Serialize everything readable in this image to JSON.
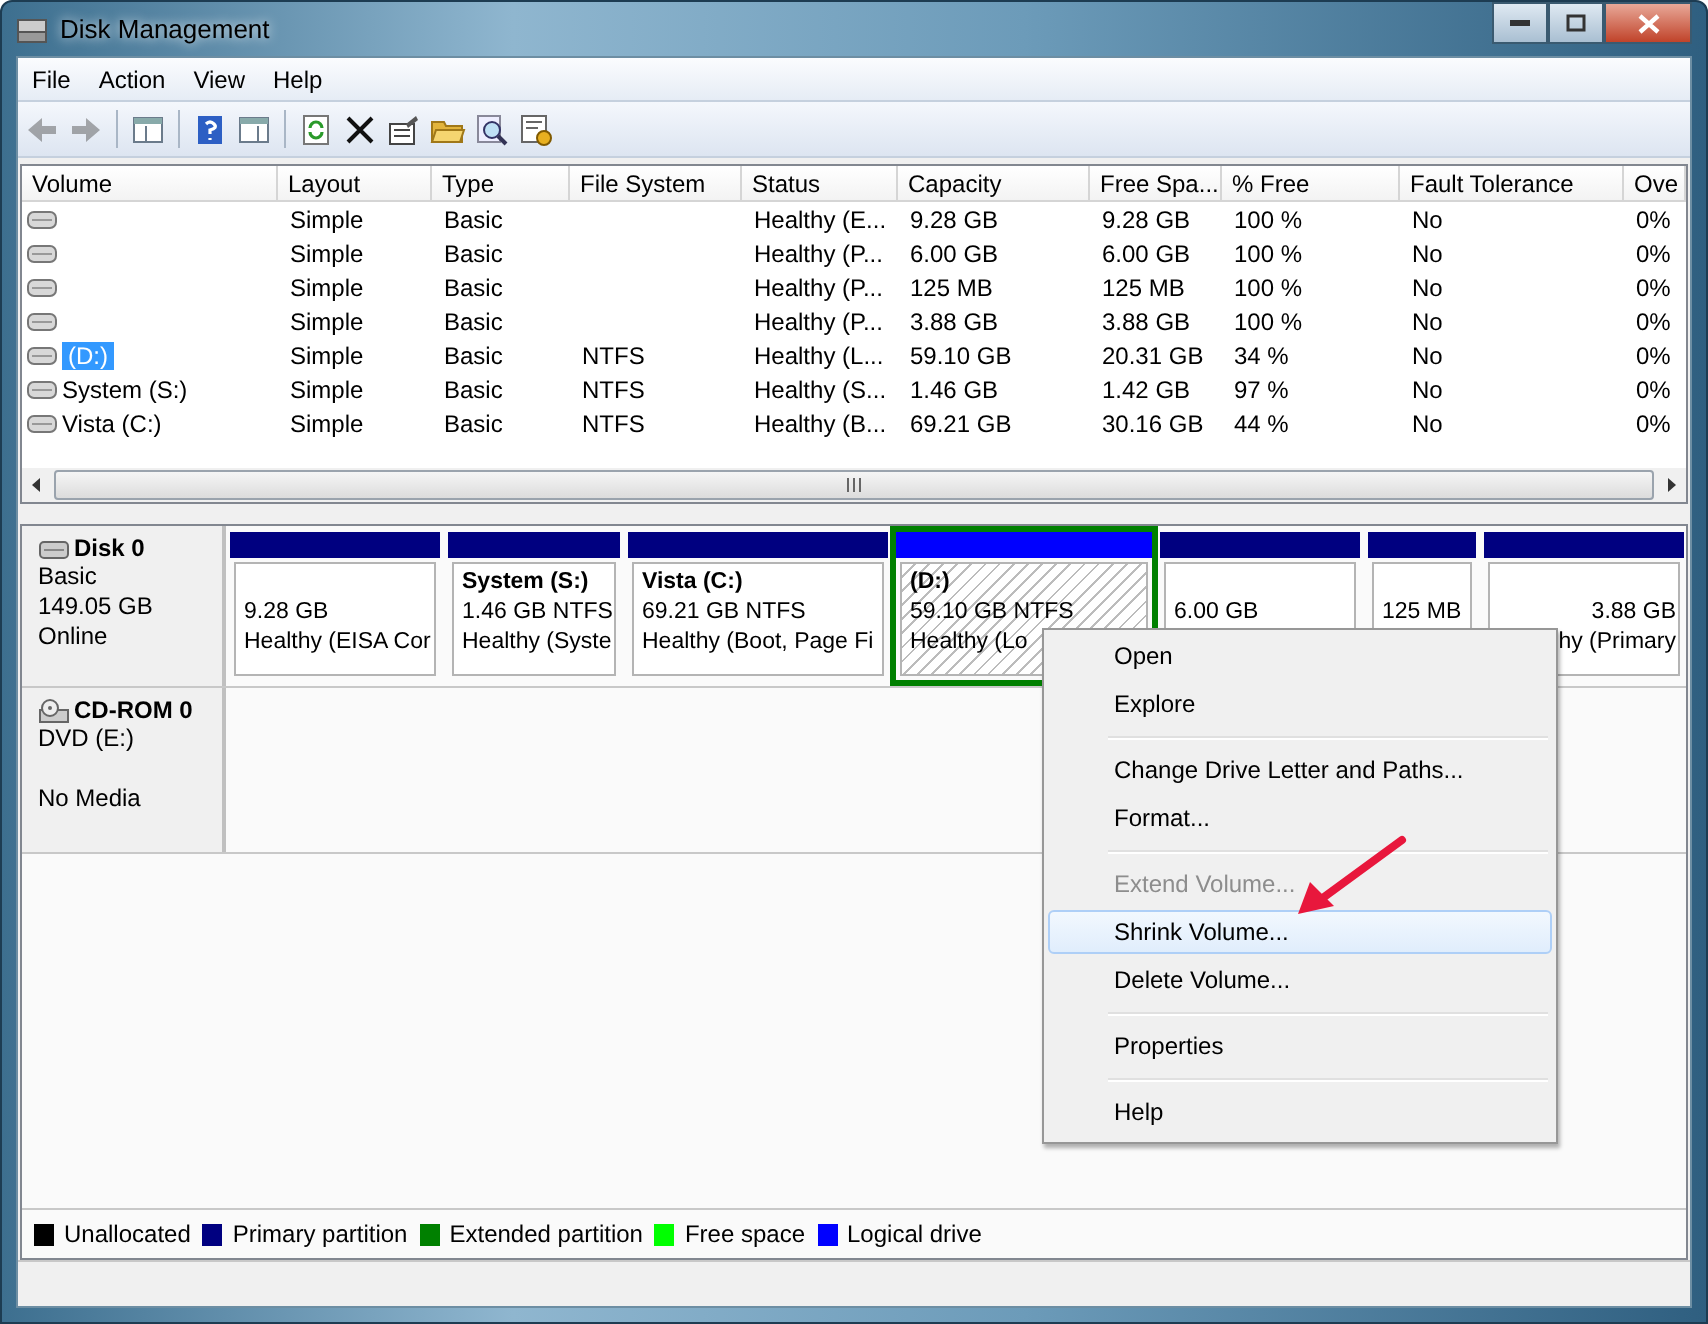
{
  "window": {
    "title": "Disk Management"
  },
  "menu": [
    "File",
    "Action",
    "View",
    "Help"
  ],
  "toolbar": [
    {
      "kind": "back",
      "disabled": true
    },
    {
      "kind": "forward",
      "disabled": true
    },
    {
      "kind": "separator"
    },
    {
      "kind": "tree",
      "disabled": false
    },
    {
      "kind": "separator"
    },
    {
      "kind": "help",
      "disabled": false
    },
    {
      "kind": "pane",
      "disabled": false
    },
    {
      "kind": "separator"
    },
    {
      "kind": "refresh",
      "disabled": false
    },
    {
      "kind": "delete",
      "disabled": false
    },
    {
      "kind": "properties",
      "disabled": false
    },
    {
      "kind": "open",
      "disabled": false
    },
    {
      "kind": "search",
      "disabled": false
    },
    {
      "kind": "settings",
      "disabled": false
    }
  ],
  "table": {
    "columns": [
      "Volume",
      "Layout",
      "Type",
      "File System",
      "Status",
      "Capacity",
      "Free Spa...",
      "% Free",
      "Fault Tolerance",
      "Ove"
    ],
    "rows": [
      {
        "selected": false,
        "cells": [
          null,
          "Simple",
          "Basic",
          null,
          "Healthy (E...",
          "9.28 GB",
          "9.28 GB",
          "100 %",
          "No",
          "0%"
        ]
      },
      {
        "selected": false,
        "cells": [
          null,
          "Simple",
          "Basic",
          null,
          "Healthy (P...",
          "6.00 GB",
          "6.00 GB",
          "100 %",
          "No",
          "0%"
        ]
      },
      {
        "selected": false,
        "cells": [
          null,
          "Simple",
          "Basic",
          null,
          "Healthy (P...",
          "125 MB",
          "125 MB",
          "100 %",
          "No",
          "0%"
        ]
      },
      {
        "selected": false,
        "cells": [
          null,
          "Simple",
          "Basic",
          null,
          "Healthy (P...",
          "3.88 GB",
          "3.88 GB",
          "100 %",
          "No",
          "0%"
        ]
      },
      {
        "selected": true,
        "cells": [
          "(D:)",
          "Simple",
          "Basic",
          "NTFS",
          "Healthy (L...",
          "59.10 GB",
          "20.31 GB",
          "34 %",
          "No",
          "0%"
        ]
      },
      {
        "selected": false,
        "cells": [
          "System (S:)",
          "Simple",
          "Basic",
          "NTFS",
          "Healthy (S...",
          "1.46 GB",
          "1.42 GB",
          "97 %",
          "No",
          "0%"
        ]
      },
      {
        "selected": false,
        "cells": [
          "Vista (C:)",
          "Simple",
          "Basic",
          "NTFS",
          "Healthy (B...",
          "69.21 GB",
          "30.16 GB",
          "44 %",
          "No",
          "0%"
        ]
      }
    ]
  },
  "disks": [
    {
      "kind": "disk",
      "name": "Disk 0",
      "type": "Basic",
      "size": "149.05 GB",
      "state": "Online",
      "partitions": [
        {
          "size": "9.28 GB",
          "status": "Healthy (EISA Cor",
          "color": "#000080",
          "selected": false,
          "extended": false
        },
        {
          "name": "System  (S:)",
          "size": "1.46 GB NTFS",
          "status": "Healthy (Syste",
          "color": "#000080",
          "selected": false,
          "extended": false
        },
        {
          "name": "Vista  (C:)",
          "size": "69.21 GB NTFS",
          "status": "Healthy (Boot, Page Fi",
          "color": "#000080",
          "selected": false,
          "extended": false
        },
        {
          "name": "(D:)",
          "size": "59.10 GB NTFS",
          "status": "Healthy (Lo",
          "color": "#0000ff",
          "selected": true,
          "extended": true
        },
        {
          "size": "6.00 GB",
          "color": "#000080",
          "selected": false,
          "extended": false
        },
        {
          "size": "125 MB",
          "color": "#000080",
          "selected": false,
          "extended": false
        },
        {
          "size": "3.88 GB",
          "status": "hy (Primary",
          "color": "#000080",
          "selected": false,
          "extended": false,
          "partly_covered": true
        }
      ]
    },
    {
      "kind": "cdrom",
      "name": "CD-ROM 0",
      "type": "DVD (E:)",
      "state": "No Media"
    }
  ],
  "legend": [
    {
      "label": "Unallocated",
      "color": "#000000"
    },
    {
      "label": "Primary partition",
      "color": "#000080"
    },
    {
      "label": "Extended partition",
      "color": "#008000"
    },
    {
      "label": "Free space",
      "color": "#00ff00"
    },
    {
      "label": "Logical drive",
      "color": "#0000ff"
    }
  ],
  "context_menu": [
    {
      "label": "Open",
      "disabled": false,
      "selected": false,
      "divider_above": false
    },
    {
      "label": "Explore",
      "disabled": false,
      "selected": false,
      "divider_above": false
    },
    {
      "label": "Change Drive Letter and Paths...",
      "disabled": false,
      "selected": false,
      "divider_above": true
    },
    {
      "label": "Format...",
      "disabled": false,
      "selected": false,
      "divider_above": false
    },
    {
      "label": "Extend Volume...",
      "disabled": true,
      "selected": false,
      "divider_above": true
    },
    {
      "label": "Shrink Volume...",
      "disabled": false,
      "selected": true,
      "divider_above": false
    },
    {
      "label": "Delete Volume...",
      "disabled": false,
      "selected": false,
      "divider_above": false
    },
    {
      "label": "Properties",
      "disabled": false,
      "selected": false,
      "divider_above": true
    },
    {
      "label": "Help",
      "disabled": false,
      "selected": false,
      "divider_above": true
    }
  ]
}
